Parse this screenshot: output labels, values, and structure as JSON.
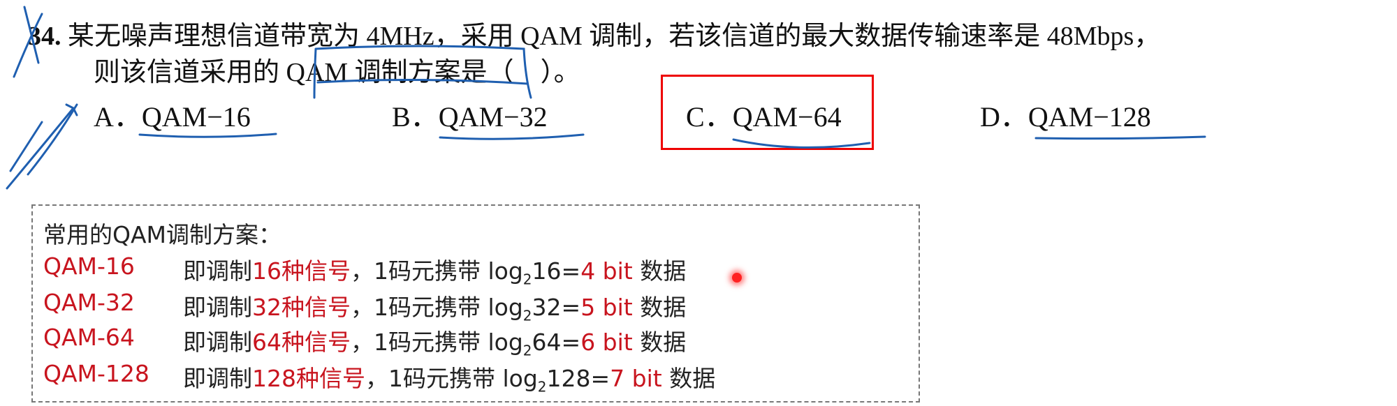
{
  "question": {
    "number": "34.",
    "line1": "某无噪声理想信道带宽为 4MHz，采用 QAM 调制，若该信道的最大数据传输速率是 48Mbps，",
    "line2": "则该信道采用的 QAM 调制方案是（　）。",
    "options": [
      {
        "letter": "A．",
        "text": "QAM−16"
      },
      {
        "letter": "B．",
        "text": "QAM−32"
      },
      {
        "letter": "C．",
        "text": "QAM−64"
      },
      {
        "letter": "D．",
        "text": "QAM−128"
      }
    ],
    "highlighted_option": "C"
  },
  "note": {
    "title": "常用的QAM调制方案：",
    "rows": [
      {
        "name": "QAM-16",
        "pre": "即调制",
        "signals": "16种信号",
        "mid": "，1码元携带 log",
        "sub": "2",
        "arg": "16=",
        "bits": "4 bit",
        "post": " 数据"
      },
      {
        "name": "QAM-32",
        "pre": "即调制",
        "signals": "32种信号",
        "mid": "，1码元携带 log",
        "sub": "2",
        "arg": "32=",
        "bits": "5 bit",
        "post": " 数据"
      },
      {
        "name": "QAM-64",
        "pre": "即调制",
        "signals": "64种信号",
        "mid": "，1码元携带 log",
        "sub": "2",
        "arg": "64=",
        "bits": "6 bit",
        "post": " 数据"
      },
      {
        "name": "QAM-128",
        "pre": "即调制",
        "signals": "128种信号",
        "mid": "，1码元携带 log",
        "sub": "2",
        "arg": "128=",
        "bits": "7 bit",
        "post": " 数据"
      }
    ]
  },
  "colors": {
    "accent_red": "#c8141e",
    "box_red": "#e00000",
    "ink_blue": "#1f5fb0"
  }
}
